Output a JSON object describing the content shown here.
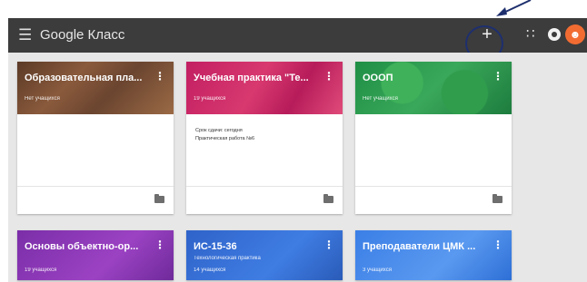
{
  "header": {
    "menu_icon": "hamburger-icon",
    "title": "Google Класс",
    "add_label": "+",
    "apps_icon": "grid-icon",
    "account_icon": "account-circle-icon",
    "avatar_icon": "user-avatar-icon"
  },
  "cards": [
    {
      "title": "Образовательная пла...",
      "sub": "Нет учащихся",
      "lines": []
    },
    {
      "title": "Учебная практика \"Те...",
      "sub": "19 учащихся",
      "lines": [
        "Срок сдачи: сегодня",
        "Практическая работа №6"
      ]
    },
    {
      "title": "ОООП",
      "sub": "Нет учащихся",
      "lines": []
    },
    {
      "title": "Основы объектно-ор...",
      "sub": "19 учащихся",
      "lines": []
    },
    {
      "title": "ИС-15-36",
      "sub": "14 учащихся",
      "sub2": "Технологическая практика"
    },
    {
      "title": "Преподаватели ЦМК ...",
      "sub": "3 учащихся"
    }
  ],
  "colors": {
    "header_bg": "#3c3c3c",
    "content_bg": "#e7e7e7",
    "avatar": "#f26c32",
    "annotation": "#1e2f6e"
  }
}
